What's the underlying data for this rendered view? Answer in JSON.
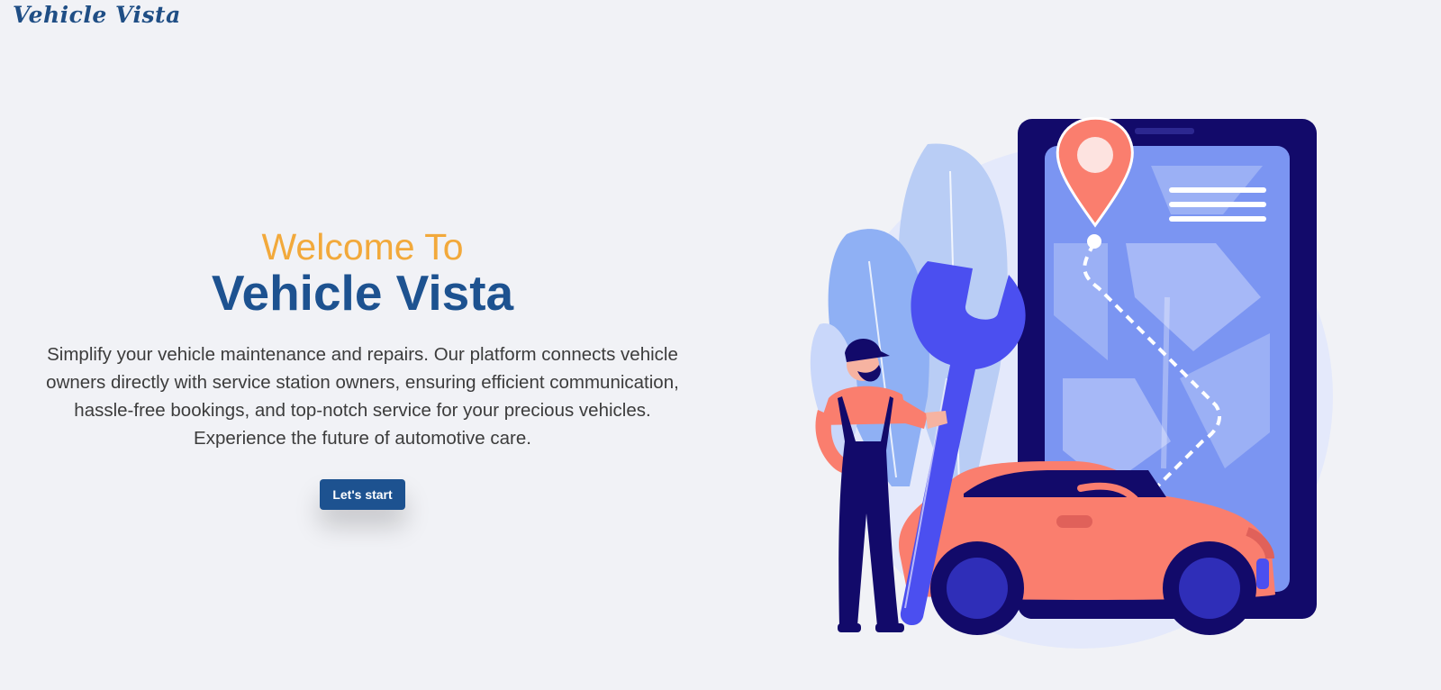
{
  "header": {
    "logo_text": "Vehicle Vista"
  },
  "hero": {
    "welcome": "Welcome To",
    "title": "Vehicle Vista",
    "description": "Simplify your vehicle maintenance and repairs. Our platform connects vehicle owners directly with service station owners, ensuring efficient communication, hassle-free bookings, and top-notch service for your precious vehicles. Experience the future of automotive care.",
    "cta_label": "Let's start"
  },
  "illustration": {
    "icons": [
      "mechanic-illustration",
      "wrench-icon",
      "phone-map-illustration",
      "location-pin-icon",
      "car-illustration"
    ]
  },
  "colors": {
    "background": "#f1f2f6",
    "primary": "#1d5290",
    "accent": "#f2a93b",
    "illustration_blue": "#4b4ff0",
    "illustration_navy": "#120a6a",
    "illustration_coral": "#fa7e6e"
  }
}
